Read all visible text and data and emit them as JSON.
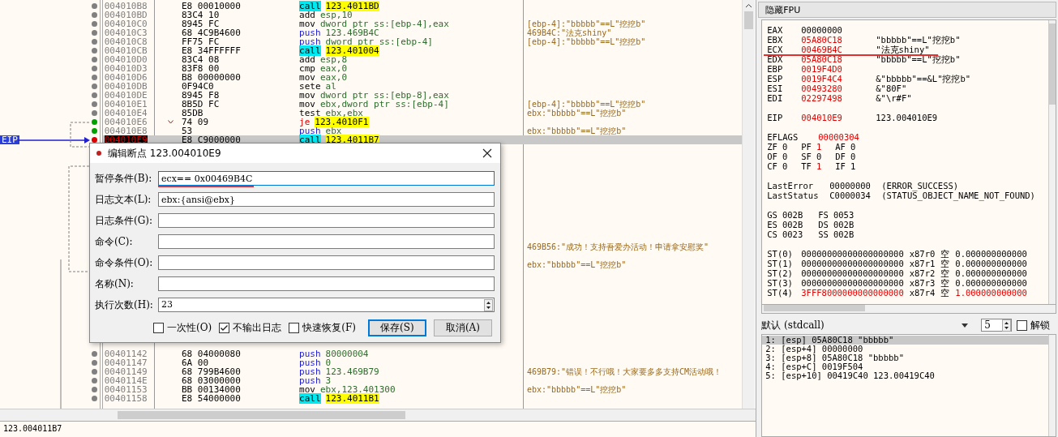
{
  "disassembly": {
    "rows": [
      {
        "address": "004010B8",
        "bytes": "E8 00010000",
        "instruction": {
          "kind": "call",
          "mnemonic": "call",
          "operand": "123.4011BD"
        },
        "color": "#808080",
        "selected": false
      },
      {
        "address": "004010BD",
        "bytes": "83C4 10",
        "instruction": {
          "kind": "other",
          "mnemonic": "add",
          "operand": "esp,10"
        },
        "color": "#808080",
        "selected": false
      },
      {
        "address": "004010C0",
        "bytes": "8945 FC",
        "instruction": {
          "kind": "other",
          "mnemonic": "mov",
          "operand": "dword ptr ss:[ebp-4],eax"
        },
        "comment": "[ebp-4]:\"bbbbb\"==L\"挖挖b\"",
        "color": "#808080",
        "selected": false
      },
      {
        "address": "004010C3",
        "bytes": "68 4C9B4600",
        "instruction": {
          "kind": "push",
          "mnemonic": "push",
          "operand": "123.469B4C"
        },
        "comment": "469B4C:\"法克shiny\"",
        "color": "#808080",
        "selected": false
      },
      {
        "address": "004010C8",
        "bytes": "FF75 FC",
        "instruction": {
          "kind": "push",
          "mnemonic": "push",
          "operand": "dword ptr ss:[ebp-4]"
        },
        "comment": "[ebp-4]:\"bbbbb\"==L\"挖挖b\"",
        "color": "#808080",
        "selected": false
      },
      {
        "address": "004010CB",
        "bytes": "E8 34FFFFFF",
        "instruction": {
          "kind": "call",
          "mnemonic": "call",
          "operand": "123.401004"
        },
        "color": "#808080",
        "selected": false
      },
      {
        "address": "004010D0",
        "bytes": "83C4 08",
        "instruction": {
          "kind": "other",
          "mnemonic": "add",
          "operand": "esp,8"
        },
        "color": "#808080",
        "selected": false
      },
      {
        "address": "004010D3",
        "bytes": "83F8 00",
        "instruction": {
          "kind": "other",
          "mnemonic": "cmp",
          "operand": "eax,0"
        },
        "color": "#808080",
        "selected": false
      },
      {
        "address": "004010D6",
        "bytes": "B8 00000000",
        "instruction": {
          "kind": "other",
          "mnemonic": "mov",
          "operand": "eax,0"
        },
        "color": "#808080",
        "selected": false
      },
      {
        "address": "004010DB",
        "bytes": "0F94C0",
        "instruction": {
          "kind": "other",
          "mnemonic": "sete",
          "operand": "al"
        },
        "color": "#808080",
        "selected": false
      },
      {
        "address": "004010DE",
        "bytes": "8945 F8",
        "instruction": {
          "kind": "other",
          "mnemonic": "mov",
          "operand": "dword ptr ss:[ebp-8],eax"
        },
        "color": "#808080",
        "selected": false
      },
      {
        "address": "004010E1",
        "bytes": "8B5D FC",
        "instruction": {
          "kind": "other",
          "mnemonic": "mov",
          "operand": "ebx,dword ptr ss:[ebp-4]"
        },
        "comment": "[ebp-4]:\"bbbbb\"==L\"挖挖b\"",
        "color": "#808080",
        "selected": false
      },
      {
        "address": "004010E4",
        "bytes": "85DB",
        "instruction": {
          "kind": "other",
          "mnemonic": "test",
          "operand": "ebx,ebx"
        },
        "comment": "ebx:\"bbbbb\"==L\"挖挖b\"",
        "color": "#808080",
        "selected": false
      },
      {
        "address": "004010E6",
        "bytes": "74 09",
        "branch": true,
        "instruction": {
          "kind": "jump",
          "mnemonic": "je",
          "operand": "123.4010F1"
        },
        "color": "#00a000",
        "selected": false
      },
      {
        "address": "004010E8",
        "bytes": "53",
        "instruction": {
          "kind": "push",
          "mnemonic": "push",
          "operand": "ebx"
        },
        "comment": "ebx:\"bbbbb\"==L\"挖挖b\"",
        "color": "#00a000",
        "selected": false
      },
      {
        "eip_label": "EIP",
        "address": "004010E9",
        "bytes": "E8 C9000000",
        "instruction": {
          "kind": "call",
          "mnemonic": "call",
          "operand": "123.4011B7"
        },
        "color": "#e00000",
        "selected": true
      },
      {},
      {},
      {},
      {},
      {},
      {},
      {},
      {},
      {},
      {},
      {},
      {
        "comment": "469B56:\"成功！支持吾爱办活动！申请拿安慰奖\"",
        "selected": false
      },
      {},
      {
        "comment": "ebx:\"bbbbb\"==L\"挖挖b\"",
        "selected": false
      },
      {},
      {},
      {},
      {},
      {},
      {},
      {},
      {},
      {},
      {
        "address": "00401142",
        "bytes": "68 04000080",
        "instruction": {
          "kind": "push",
          "mnemonic": "push",
          "operand": "80000004"
        },
        "color": "#808080",
        "selected": false
      },
      {
        "address": "00401147",
        "bytes": "6A 00",
        "instruction": {
          "kind": "push",
          "mnemonic": "push",
          "operand": "0"
        },
        "color": "#808080",
        "selected": false
      },
      {
        "address": "00401149",
        "bytes": "68 799B4600",
        "instruction": {
          "kind": "push",
          "mnemonic": "push",
          "operand": "123.469B79"
        },
        "comment": "469B79:\"错误！不行哦！大家要多多支持CM活动哦！",
        "color": "#808080",
        "selected": false
      },
      {
        "address": "0040114E",
        "bytes": "68 03000000",
        "instruction": {
          "kind": "push",
          "mnemonic": "push",
          "operand": "3"
        },
        "color": "#808080",
        "selected": false
      },
      {
        "address": "00401153",
        "bytes": "BB 00134000",
        "instruction": {
          "kind": "other",
          "mnemonic": "mov",
          "operand": "ebx,123.401300"
        },
        "comment": "ebx:\"bbbbb\"==L\"挖挖b\"",
        "color": "#808080",
        "selected": false
      },
      {
        "address": "00401158",
        "bytes": "E8 54000000",
        "instruction": {
          "kind": "call",
          "mnemonic": "call",
          "operand": "123.4011B1"
        },
        "color": "#808080",
        "selected": false
      }
    ]
  },
  "status_bar": "123.004011B7",
  "dialog": {
    "title": "编辑断点 123.004010E9",
    "fields": [
      {
        "label": "暂停条件(B):",
        "value": "ecx== 0x00469B4C",
        "kind": "text",
        "focused": true
      },
      {
        "label": "日志文本(L):",
        "value": "ebx:{ansi@ebx}",
        "kind": "text",
        "focused": false
      },
      {
        "label": "日志条件(G):",
        "kind": "text",
        "focused": false
      },
      {
        "label": "命令(C):",
        "kind": "text",
        "focused": false
      },
      {
        "label": "命令条件(O):",
        "kind": "text",
        "focused": false
      },
      {
        "label": "名称(N):",
        "kind": "text",
        "focused": false
      },
      {
        "label": "执行次数(H):",
        "value": "23",
        "kind": "spin",
        "focused": false
      }
    ],
    "checkboxes": [
      {
        "label": "一次性(O)",
        "checked": false
      },
      {
        "label": "不输出日志",
        "checked": true
      },
      {
        "label": "快速恢复(F)",
        "checked": false
      }
    ],
    "buttons": [
      {
        "label": "保存(S)",
        "default": true
      },
      {
        "label": "取消(A)",
        "default": false
      }
    ]
  },
  "registers": {
    "toggle_button": "隐藏FPU",
    "general": [
      {
        "name": "EAX",
        "value": "00000000",
        "changed": false
      },
      {
        "name": "EBX",
        "value": "05A80C18",
        "changed": true,
        "comment": "\"bbbbb\"==L\"挖挖b\""
      },
      {
        "name": "ECX",
        "value": "00469B4C",
        "changed": true,
        "comment": "\"法克shiny\""
      },
      {
        "name": "EDX",
        "value": "05A80C18",
        "changed": true,
        "comment": "\"bbbbb\"==L\"挖挖b\""
      },
      {
        "name": "EBP",
        "value": "0019F4D0",
        "changed": true
      },
      {
        "name": "ESP",
        "value": "0019F4C4",
        "changed": true,
        "comment": "&\"bbbbb\"==&L\"挖挖b\""
      },
      {
        "name": "ESI",
        "value": "00493280",
        "changed": true,
        "comment": "&\"80F\""
      },
      {
        "name": "EDI",
        "value": "02297498",
        "changed": true,
        "comment": "&\"\\r#F\""
      }
    ],
    "eip": {
      "name": "EIP",
      "value": "004010E9",
      "changed": true,
      "comment": "123.004010E9"
    },
    "eflags": {
      "name": "EFLAGS",
      "value": "00000304",
      "changed": true
    },
    "flag_rows": [
      {
        "flags": [
          {
            "name": "ZF",
            "value": "0",
            "changed": false
          },
          {
            "name": "PF",
            "value": "1",
            "changed": true
          },
          {
            "name": "AF",
            "value": "0",
            "changed": false
          }
        ]
      },
      {
        "flags": [
          {
            "name": "OF",
            "value": "0",
            "changed": false
          },
          {
            "name": "SF",
            "value": "0",
            "changed": false
          },
          {
            "name": "DF",
            "value": "0",
            "changed": false
          }
        ]
      },
      {
        "flags": [
          {
            "name": "CF",
            "value": "0",
            "changed": false
          },
          {
            "name": "TF",
            "value": "1",
            "changed": true
          },
          {
            "name": "IF",
            "value": "1",
            "changed": false
          }
        ]
      }
    ],
    "errors": [
      {
        "name": "LastError",
        "code": "00000000",
        "text": "(ERROR_SUCCESS)"
      },
      {
        "name": "LastStatus",
        "code": "C0000034",
        "text": "(STATUS_OBJECT_NAME_NOT_FOUND)"
      }
    ],
    "segment_rows": [
      {
        "segments": [
          {
            "name": "GS",
            "value": "002B"
          },
          {
            "name": "FS",
            "value": "0053"
          }
        ]
      },
      {
        "segments": [
          {
            "name": "ES",
            "value": "002B"
          },
          {
            "name": "DS",
            "value": "002B"
          }
        ]
      },
      {
        "segments": [
          {
            "name": "CS",
            "value": "0023"
          },
          {
            "name": "SS",
            "value": "002B"
          }
        ]
      }
    ],
    "fpu": [
      {
        "name": "ST(0)",
        "raw": "00000000000000000000",
        "tag": "x87r0",
        "state": "空",
        "value": "0.000000000000",
        "changed": false
      },
      {
        "name": "ST(1)",
        "raw": "00000000000000000000",
        "tag": "x87r1",
        "state": "空",
        "value": "0.000000000000",
        "changed": false
      },
      {
        "name": "ST(2)",
        "raw": "00000000000000000000",
        "tag": "x87r2",
        "state": "空",
        "value": "0.000000000000",
        "changed": false
      },
      {
        "name": "ST(3)",
        "raw": "00000000000000000000",
        "tag": "x87r3",
        "state": "空",
        "value": "0.000000000000",
        "changed": false
      },
      {
        "name": "ST(4)",
        "raw": "3FFF8000000000000000",
        "tag": "x87r4",
        "state": "空",
        "value": "1.000000000000",
        "changed": true
      }
    ]
  },
  "call_stack": {
    "convention": "默认 (stdcall)",
    "arg_count": "5",
    "lock": {
      "label": "解锁",
      "checked": false
    },
    "args": [
      {
        "text": "1: [esp] 05A80C18 \"bbbbb\"",
        "selected": true
      },
      {
        "text": "2: [esp+4] 00000000",
        "selected": false
      },
      {
        "text": "3: [esp+8] 05A80C18 \"bbbbb\"",
        "selected": false
      },
      {
        "text": "4: [esp+C] 0019F504",
        "selected": false
      },
      {
        "text": "5: [esp+10] 00419C40 123.00419C40",
        "selected": false
      }
    ]
  }
}
